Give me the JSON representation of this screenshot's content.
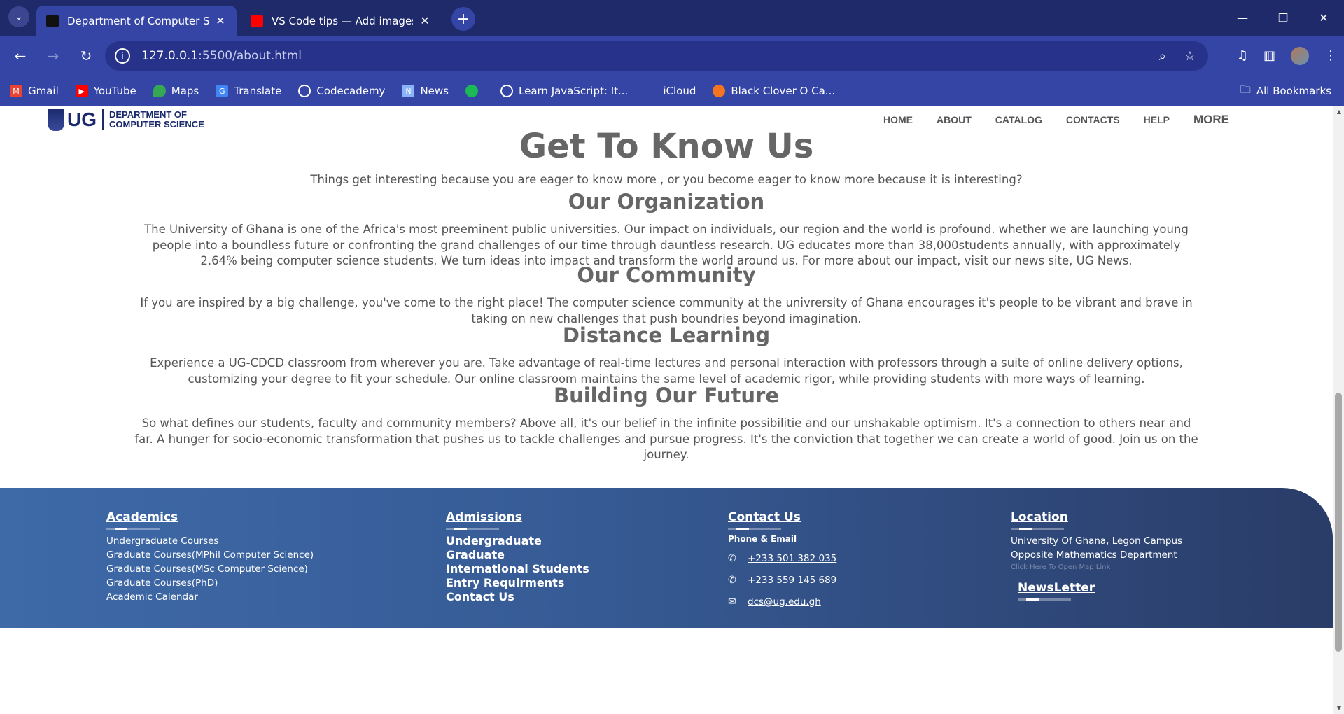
{
  "browser": {
    "tabs": [
      {
        "title": "Department of Computer Science",
        "favicon": "page-icon",
        "active": true
      },
      {
        "title": "VS Code tips — Add images and",
        "favicon": "youtube-icon",
        "active": false
      }
    ],
    "url_host": "127.0.0.1",
    "url_path": ":5500/about.html",
    "bookmarks": [
      {
        "label": "Gmail",
        "icon": "gmail-icon",
        "color": "#ea4335"
      },
      {
        "label": "YouTube",
        "icon": "youtube-icon",
        "color": "#ff0000"
      },
      {
        "label": "Maps",
        "icon": "maps-icon",
        "color": "#34a853"
      },
      {
        "label": "Translate",
        "icon": "translate-icon",
        "color": "#4285f4"
      },
      {
        "label": "Codecademy",
        "icon": "globe-icon",
        "color": "#ffffff"
      },
      {
        "label": "News",
        "icon": "news-icon",
        "color": "#8ab4f8"
      },
      {
        "label": "",
        "icon": "spotify-icon",
        "color": "#1db954"
      },
      {
        "label": "Learn JavaScript: It...",
        "icon": "globe-icon",
        "color": "#ffffff"
      },
      {
        "label": "iCloud",
        "icon": "apple-icon",
        "color": "#cccccc"
      },
      {
        "label": "Black Clover O Ca...",
        "icon": "crunchyroll-icon",
        "color": "#f47521"
      }
    ],
    "all_bookmarks": "All Bookmarks"
  },
  "site": {
    "logo_text": "UG",
    "logo_dept_line1": "DEPARTMENT OF",
    "logo_dept_line2": "COMPUTER SCIENCE",
    "nav": [
      "HOME",
      "ABOUT",
      "CATALOG",
      "CONTACTS",
      "HELP",
      "MORE"
    ]
  },
  "main": {
    "title": "Get To Know Us",
    "intro": "Things get interesting because you are eager to know more , or you become eager to know more because it is interesting?",
    "sections": [
      {
        "heading": "Our Organization",
        "text": "The University of Ghana is one of the Africa's most preeminent public universities. Our impact on individuals, our region and the world is profound. whether we are launching young people into a boundless future or confronting the grand challenges of our time through dauntless research. UG educates more than 38,000students annually, with approximately 2.64% being computer science students. We turn ideas into impact and transform the world around us. For more about our impact, visit our news site, UG News."
      },
      {
        "heading": "Our Community",
        "text": "If you are inspired by a big challenge, you've come to the right place! The computer science community at the univrersity of Ghana encourages it's people to be vibrant and brave in taking on new challenges that push boundries beyond imagination."
      },
      {
        "heading": "Distance Learning",
        "text": "Experience a UG-CDCD classroom from wherever you are. Take advantage of real-time lectures and personal interaction with professors through a suite of online delivery options, customizing your degree to fit your schedule. Our online classroom maintains the same level of academic rigor, while providing students with more ways of learning."
      },
      {
        "heading": "Building Our Future",
        "text": "So what defines our students, faculty and community members? Above all, it's our belief in the infinite possibilitie and our unshakable optimism. It's a connection to others near and far. A hunger for socio-economic transformation that pushes us to tackle challenges and pursue progress. It's the conviction that together we can create a world of good. Join us on the journey."
      }
    ]
  },
  "footer": {
    "academics": {
      "heading": "Academics",
      "items": [
        "Undergraduate Courses",
        "Graduate Courses(MPhil Computer Science)",
        "Graduate Courses(MSc Computer Science)",
        "Graduate Courses(PhD)",
        "Academic Calendar"
      ]
    },
    "admissions": {
      "heading": "Admissions",
      "items": [
        "Undergraduate",
        "Graduate",
        "International Students",
        "Entry Requirments",
        "Contact Us"
      ]
    },
    "contact": {
      "heading": "Contact Us",
      "subheading": "Phone & Email",
      "phones": [
        "+233 501 382 035",
        "+233 559 145 689"
      ],
      "email": "dcs@ug.edu.gh"
    },
    "location": {
      "heading": "Location",
      "line1": "University Of Ghana, Legon Campus",
      "line2": "Opposite Mathematics Department",
      "map_link": "Click Here To Open Map Link",
      "newsletter": "NewsLetter"
    }
  }
}
